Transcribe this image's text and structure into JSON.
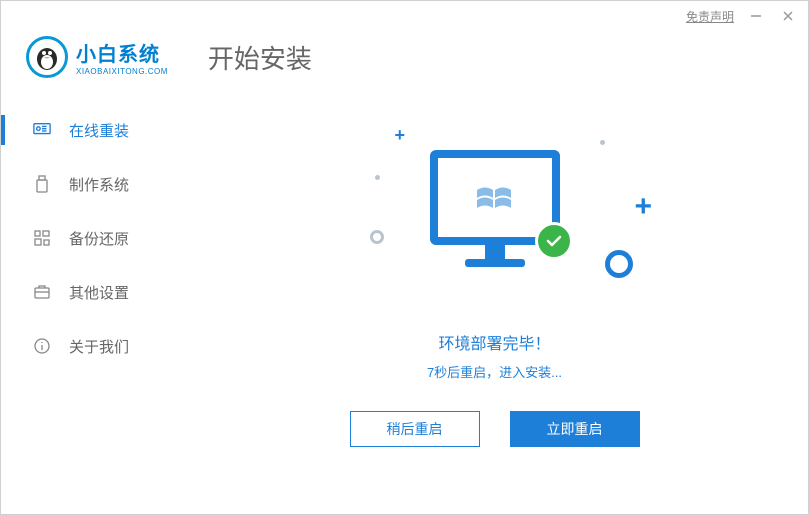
{
  "titlebar": {
    "disclaimer": "免责声明"
  },
  "logo": {
    "title": "小白系统",
    "subtitle": "XIAOBAIXITONG.COM"
  },
  "page_title": "开始安装",
  "sidebar": {
    "items": [
      {
        "label": "在线重装"
      },
      {
        "label": "制作系统"
      },
      {
        "label": "备份还原"
      },
      {
        "label": "其他设置"
      },
      {
        "label": "关于我们"
      }
    ]
  },
  "main": {
    "status_title": "环境部署完毕！",
    "status_sub": "7秒后重启，进入安装...",
    "btn_later": "稍后重启",
    "btn_now": "立即重启"
  }
}
